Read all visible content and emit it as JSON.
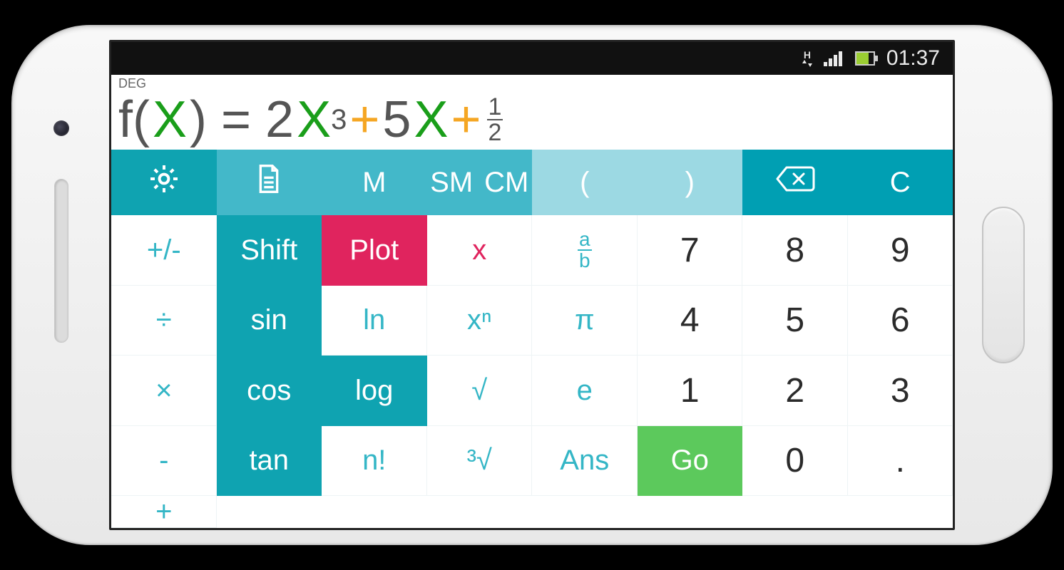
{
  "status": {
    "time": "01:37",
    "data_indicator": "H"
  },
  "display": {
    "mode": "DEG",
    "expr": {
      "f_label": "f(",
      "var1": "X",
      "close_eq": ") = 2",
      "var2": "X",
      "pow": "3",
      "plus1": " + ",
      "coef2": "5",
      "var3": "X",
      "plus2": " + ",
      "frac_num": "1",
      "frac_den": "2"
    }
  },
  "row_top": {
    "mem": "M",
    "sm": "SM",
    "cm": "CM",
    "paren_open": "(",
    "paren_close": ")",
    "clear": "C",
    "plus_minus": "+/-"
  },
  "row1": {
    "shift": "Shift",
    "plot": "Plot",
    "x": "x",
    "ab_num": "a",
    "ab_den": "b",
    "n7": "7",
    "n8": "8",
    "n9": "9",
    "div": "÷"
  },
  "row2": {
    "sin": "sin",
    "ln": "ln",
    "xn": "xⁿ",
    "pi": "π",
    "n4": "4",
    "n5": "5",
    "n6": "6",
    "mul": "×"
  },
  "row3": {
    "cos": "cos",
    "log": "log",
    "sqrt": "√",
    "e": "e",
    "n1": "1",
    "n2": "2",
    "n3": "3",
    "sub": "-"
  },
  "row4": {
    "tan": "tan",
    "fact": "n!",
    "cbrt": "³√",
    "ans": "Ans",
    "go": "Go",
    "n0": "0",
    "dot": ".",
    "add": "+"
  }
}
